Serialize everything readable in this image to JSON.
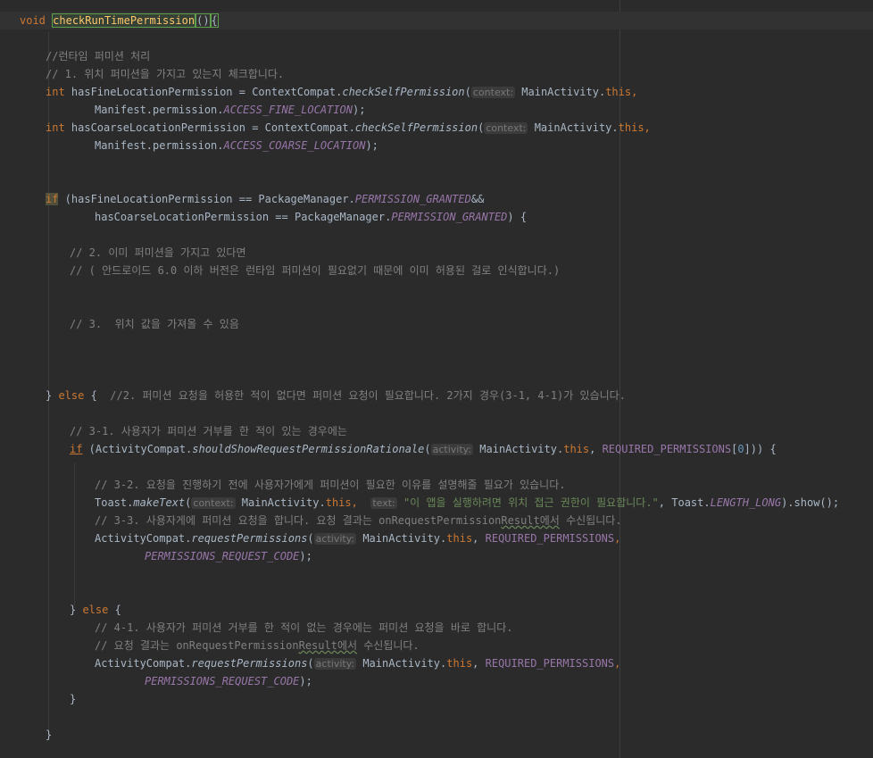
{
  "editor": {
    "l1": {
      "kw": "void",
      "name": "checkRunTimePermission",
      "parens": "()",
      "brace": "{"
    },
    "l2": {
      "text": "//런타임 퍼미션 처리"
    },
    "l3": {
      "text": "// 1. 위치 퍼미션을 가지고 있는지 체크합니다."
    },
    "l4": {
      "kw": "int",
      "a": " hasFineLocationPermission = ContextCompat.",
      "m": "checkSelfPermission",
      "b": "(",
      "hint": "context:",
      "c": " MainActivity.",
      "d": "this",
      "e": ","
    },
    "l5": {
      "a": "Manifest.permission.",
      "c": "ACCESS_FINE_LOCATION",
      "e": ");"
    },
    "l6": {
      "kw": "int",
      "a": " hasCoarseLocationPermission = ContextCompat.",
      "m": "checkSelfPermission",
      "b": "(",
      "hint": "context:",
      "c": " MainActivity.",
      "d": "this",
      "e": ","
    },
    "l7": {
      "a": "Manifest.permission.",
      "c": "ACCESS_COARSE_LOCATION",
      "e": ");"
    },
    "l8": {
      "kw": "if",
      "a": " (hasFineLocationPermission == PackageManager.",
      "c": "PERMISSION_GRANTED",
      "e": "&&"
    },
    "l9": {
      "a": "hasCoarseLocationPermission == PackageManager.",
      "c": "PERMISSION_GRANTED",
      "e": ") {"
    },
    "l10": {
      "text": "// 2. 이미 퍼미션을 가지고 있다면"
    },
    "l11": {
      "a": "// ( 안드로이드 ",
      "n": "6.0",
      "b": " 이하 버전은 런타임 퍼미션이 필요없기 때문에 이미 허용된 걸로 인식합니다.)"
    },
    "l12": {
      "text": "// 3.  위치 값을 가져올 수 있음"
    },
    "l13": {
      "a": "} ",
      "kw": "else",
      "b": " {  ",
      "cm": "//2. 퍼미션 요청을 허용한 적이 없다면 퍼미션 요청이 필요합니다. 2가지 경우(3-1, 4-1)가 있습니다."
    },
    "l14": {
      "text": "// 3-1. 사용자가 퍼미션 거부를 한 적이 있는 경우에는"
    },
    "l15": {
      "kw": "if",
      "a": " (ActivityCompat.",
      "m": "shouldShowRequestPermissionRationale",
      "b": "(",
      "hint": "activity:",
      "c": " MainActivity.",
      "d": "this",
      "e": ", ",
      "f": "REQUIRED_PERMISSIONS",
      "g": "[",
      "n": "0",
      "h": "])) {"
    },
    "l16": {
      "text": "// 3-2. 요청을 진행하기 전에 사용자가에게 퍼미션이 필요한 이유를 설명해줄 필요가 있습니다."
    },
    "l17": {
      "a": "Toast.",
      "m": "makeText",
      "b": "(",
      "hint": "context:",
      "c": " MainActivity.",
      "d": "this",
      "e": ",  ",
      "hint2": "text:",
      "s": " \"이 앱을 실행하려면 위치 접근 권한이 필요합니다.\"",
      "f": ", Toast.",
      "g": "LENGTH_LONG",
      "h": ").show();"
    },
    "l18": {
      "a": "// 3-3. 사용자게에 퍼미션 요청을 합니다. 요청 결과는 onRequestPermission",
      "u": "Result에서",
      "b": " 수신됩니다."
    },
    "l19": {
      "a": "ActivityCompat.",
      "m": "requestPermissions",
      "b": "(",
      "hint": "activity:",
      "c": " MainActivity.",
      "d": "this",
      "e": ", ",
      "f": "REQUIRED_PERMISSIONS",
      "g": ","
    },
    "l20": {
      "c": "PERMISSIONS_REQUEST_CODE",
      "e": ");"
    },
    "l21": {
      "a": "} ",
      "kw": "else",
      "b": " {"
    },
    "l22": {
      "text": "// 4-1. 사용자가 퍼미션 거부를 한 적이 없는 경우에는 퍼미션 요청을 바로 합니다."
    },
    "l23": {
      "a": "// 요청 결과는 onRequestPermission",
      "u": "Result에서",
      "b": " 수신됩니다."
    },
    "l24": {
      "a": "ActivityCompat.",
      "m": "requestPermissions",
      "b": "(",
      "hint": "activity:",
      "c": " MainActivity.",
      "d": "this",
      "e": ", ",
      "f": "REQUIRED_PERMISSIONS",
      "g": ","
    },
    "l25": {
      "c": "PERMISSIONS_REQUEST_CODE",
      "e": ");"
    },
    "l26": {
      "text": "}"
    },
    "l27": {
      "text": "}"
    }
  },
  "colors": {
    "background": "#2b2b2b",
    "keyword": "#cc7832",
    "comment": "#808080",
    "method": "#ffc66d",
    "constant": "#9876aa",
    "string": "#6a8759",
    "number": "#6897bb",
    "text": "#a9b7c6"
  }
}
